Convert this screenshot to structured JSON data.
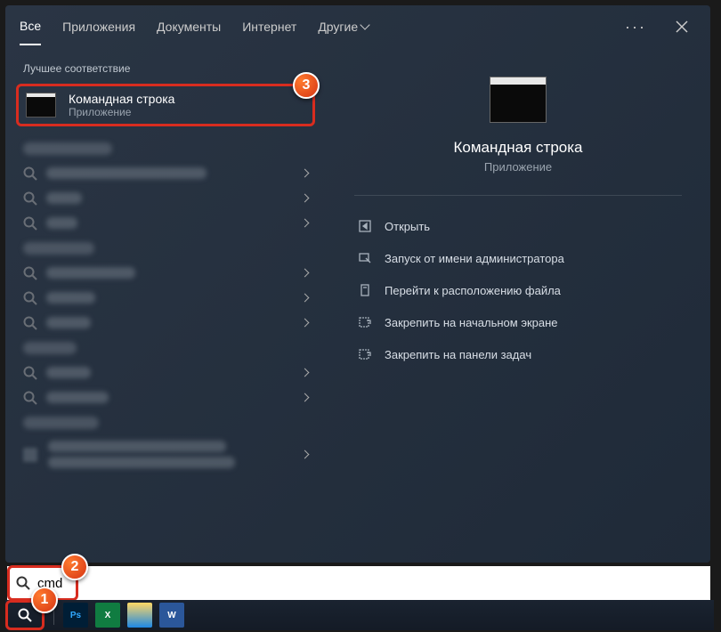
{
  "tabs": {
    "all": "Все",
    "apps": "Приложения",
    "docs": "Документы",
    "internet": "Интернет",
    "other": "Другие"
  },
  "sections": {
    "best_match": "Лучшее соответствие"
  },
  "best": {
    "title": "Командная строка",
    "subtitle": "Приложение"
  },
  "preview": {
    "title": "Командная строка",
    "subtitle": "Приложение"
  },
  "actions": {
    "open": "Открыть",
    "run_admin": "Запуск от имени администратора",
    "open_location": "Перейти к расположению файла",
    "pin_start": "Закрепить на начальном экране",
    "pin_taskbar": "Закрепить на панели задач"
  },
  "search": {
    "value": "cmd"
  },
  "callouts": {
    "one": "1",
    "two": "2",
    "three": "3"
  }
}
